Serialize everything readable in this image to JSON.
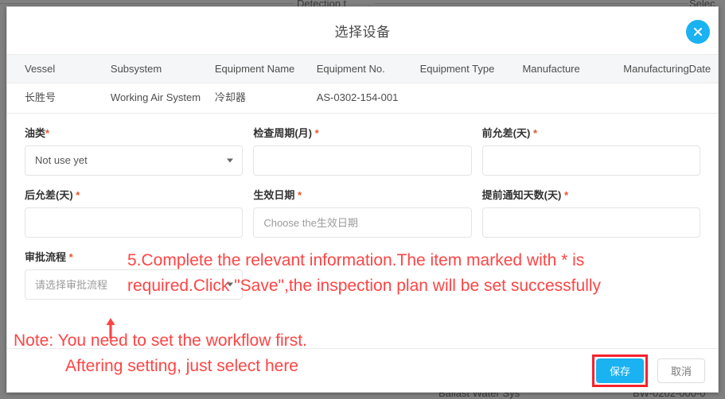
{
  "background": {
    "top_left_text": "Detection t",
    "top_right_text": "Selec",
    "bottom_left_text": "Ballast Water Sys",
    "bottom_right_text": "BW-0202-000-0"
  },
  "modal": {
    "title": "选择设备",
    "close_icon": "close-circle-icon",
    "table": {
      "columns": [
        "Vessel",
        "Subsystem",
        "Equipment Name",
        "Equipment No.",
        "Equipment Type",
        "Manufacture",
        "ManufacturingDate"
      ],
      "rows": [
        {
          "vessel": "长胜号",
          "subsystem": "Working Air System",
          "equipment_name": "冷却器",
          "equipment_no": "AS-0302-154-001",
          "equipment_type": "",
          "manufacture": "",
          "manufacturing_date": ""
        }
      ]
    },
    "form": {
      "fields": [
        {
          "label": "油类",
          "required": "*",
          "type": "select",
          "value": "Not use yet",
          "placeholder": ""
        },
        {
          "label": "检查周期(月)",
          "required": "*",
          "type": "input",
          "value": "",
          "placeholder": ""
        },
        {
          "label": "前允差(天)",
          "required": "*",
          "type": "input",
          "value": "",
          "placeholder": ""
        },
        {
          "label": "后允差(天)",
          "required": "*",
          "type": "input",
          "value": "",
          "placeholder": ""
        },
        {
          "label": "生效日期",
          "required": "*",
          "type": "date",
          "value": "",
          "placeholder": "Choose the生效日期"
        },
        {
          "label": "提前通知天数(天)",
          "required": "*",
          "type": "input",
          "value": "",
          "placeholder": ""
        },
        {
          "label": "审批流程",
          "required": "*",
          "type": "select",
          "value": "",
          "placeholder": "请选择审批流程"
        }
      ]
    },
    "footer": {
      "save_label": "保存",
      "cancel_label": "取消"
    }
  },
  "annotations": {
    "line1": "5.Complete the relevant information.The item marked with * is",
    "line2": "required.Click \"Save\",the inspection plan will be set successfully",
    "line3": "Note: You need to set the workflow first.",
    "line4": "Aftering setting, just select here",
    "arrow_icon": "arrow-up-icon",
    "color": "#ff4444",
    "highlight_color": "#f5222d"
  }
}
